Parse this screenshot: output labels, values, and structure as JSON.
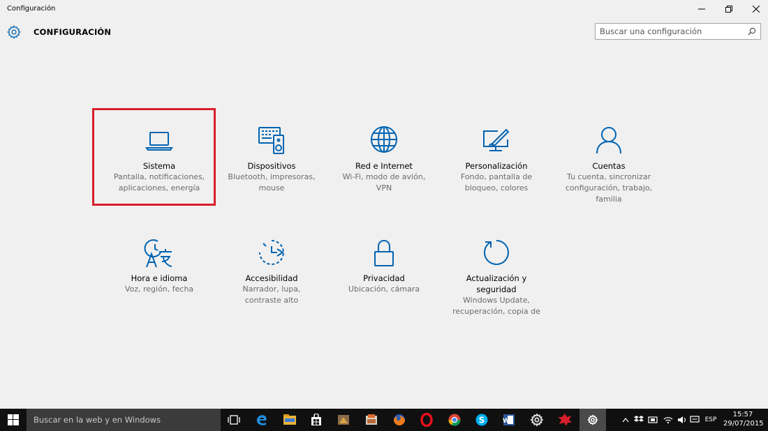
{
  "window": {
    "title": "Configuración",
    "controls": {
      "minimize": "—",
      "restore": "❐",
      "close": "✕"
    }
  },
  "header": {
    "page_title": "CONFIGURACIÓN",
    "icon": "gear-icon",
    "search_placeholder": "Buscar una configuración"
  },
  "accent_color": "#0063b1",
  "highlight_color": "#d81e2a",
  "tiles": [
    {
      "id": "sistema",
      "icon": "laptop-icon",
      "name": "Sistema",
      "desc": [
        "Pantalla, notificaciones,",
        "aplicaciones, energía"
      ]
    },
    {
      "id": "dispositivos",
      "icon": "keyboard-speaker-icon",
      "name": "Dispositivos",
      "desc": [
        "Bluetooth, impresoras,",
        "mouse"
      ]
    },
    {
      "id": "red",
      "icon": "globe-icon",
      "name": "Red e Internet",
      "desc": [
        "Wi-Fi, modo de avión,",
        "VPN"
      ]
    },
    {
      "id": "personalizacion",
      "icon": "paint-monitor-icon",
      "name": "Personalización",
      "desc": [
        "Fondo, pantalla de",
        "bloqueo, colores"
      ]
    },
    {
      "id": "cuentas",
      "icon": "person-icon",
      "name": "Cuentas",
      "desc": [
        "Tu cuenta, sincronizar",
        "configuración, trabajo,",
        "familia"
      ]
    },
    {
      "id": "hora",
      "icon": "clock-language-icon",
      "name": "Hora e idioma",
      "desc": [
        "Voz, región, fecha"
      ]
    },
    {
      "id": "accesibilidad",
      "icon": "accessibility-timer-icon",
      "name": "Accesibilidad",
      "desc": [
        "Narrador, lupa,",
        "contraste alto"
      ]
    },
    {
      "id": "privacidad",
      "icon": "lock-icon",
      "name": "Privacidad",
      "desc": [
        "Ubicación, cámara"
      ]
    },
    {
      "id": "actualizacion",
      "icon": "refresh-icon",
      "name": [
        "Actualización y",
        "seguridad"
      ],
      "desc": [
        "Windows Update,",
        "recuperación, copia de"
      ]
    }
  ],
  "taskbar": {
    "search_text": "Buscar en la web y en Windows",
    "apps": [
      "task-view-icon",
      "edge-icon",
      "file-explorer-icon",
      "store-icon",
      "app-icon",
      "app-icon",
      "firefox-icon",
      "opera-icon",
      "chrome-icon",
      "skype-icon",
      "word-icon",
      "settings-gear-icon",
      "app-icon",
      "settings-icon"
    ],
    "tray": {
      "language": "ESP",
      "time": "15:57",
      "date": "29/07/2015"
    }
  }
}
